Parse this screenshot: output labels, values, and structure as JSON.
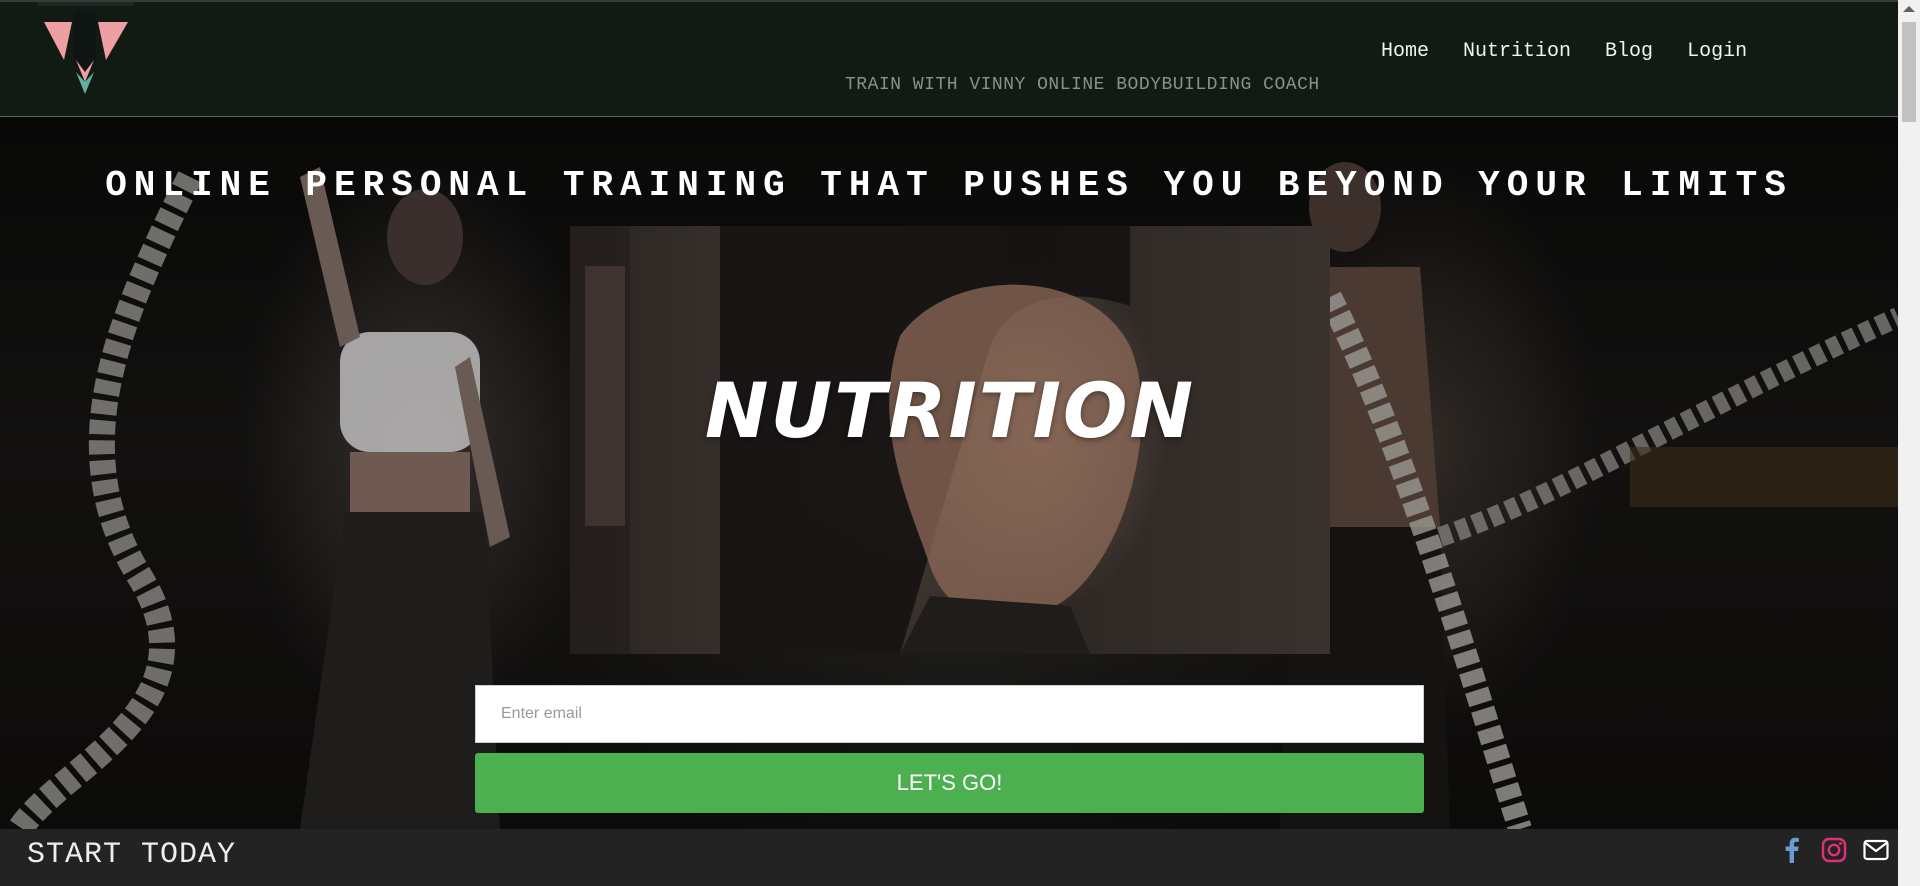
{
  "header": {
    "logo": "coaching-logo",
    "nav": [
      {
        "label": "Home"
      },
      {
        "label": "Nutrition"
      },
      {
        "label": "Blog"
      },
      {
        "label": "Login"
      }
    ],
    "tagline": "TRAIN WITH VINNY ONLINE BODYBUILDING COACH"
  },
  "hero": {
    "headline": "ONLINE PERSONAL TRAINING THAT PUSHES YOU BEYOND YOUR LIMITS",
    "feature_title": "NUTRITION",
    "email_placeholder": "Enter email",
    "cta_label": "LET'S GO!"
  },
  "footer": {
    "text": "START TODAY",
    "social": [
      {
        "icon": "facebook-icon",
        "color": "#6b9bd2"
      },
      {
        "icon": "instagram-icon",
        "color": "#e0307a"
      },
      {
        "icon": "mail-icon",
        "color": "#ffffff"
      }
    ]
  },
  "colors": {
    "header_bg": "#111a13",
    "logo_pink": "#ef9ea4",
    "logo_teal": "#5fb3a5",
    "cta_green": "#4caf50",
    "footer_bg": "#232323"
  }
}
